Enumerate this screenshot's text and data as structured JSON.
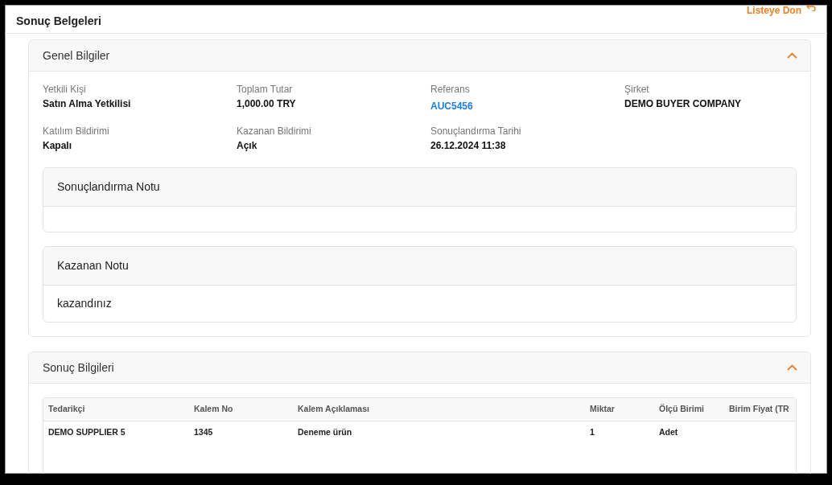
{
  "page": {
    "title": "Sonuç Belgeleri",
    "back_link": "Listeye Don"
  },
  "general": {
    "title": "Genel Bilgiler",
    "expanded": true,
    "fields": [
      {
        "label": "Yetkili Kişi",
        "value": "Satın Alma Yetkilisi",
        "kind": "text"
      },
      {
        "label": "Toplam Tutar",
        "value": "1,000.00 TRY",
        "kind": "text"
      },
      {
        "label": "Referans",
        "value": "AUC5456",
        "kind": "link"
      },
      {
        "label": "Şirket",
        "value": "DEMO BUYER COMPANY",
        "kind": "text"
      },
      {
        "label": "Katılım Bildirimi",
        "value": "Kapalı",
        "kind": "text"
      },
      {
        "label": "Kazanan Bildirimi",
        "value": "Açık",
        "kind": "text"
      },
      {
        "label": "Sonuçlandırma Tarihi",
        "value": "26.12.2024 11:38",
        "kind": "text"
      }
    ],
    "notes": [
      {
        "title": "Sonuçlandırma Notu"
      },
      {
        "title": "Kazanan Notu",
        "text": "kazandınız"
      }
    ]
  },
  "results": {
    "title": "Sonuç Bilgileri",
    "expanded": true,
    "table": {
      "columns": [
        "Tedarikçi",
        "Kalem No",
        "Kalem Açıklaması",
        "Miktar",
        "Ölçü Birimi",
        "Birim Fiyat (TR"
      ],
      "rows": [
        [
          "DEMO SUPPLIER 5",
          "1345",
          "Deneme ürün",
          "1",
          "Adet"
        ]
      ]
    }
  }
}
